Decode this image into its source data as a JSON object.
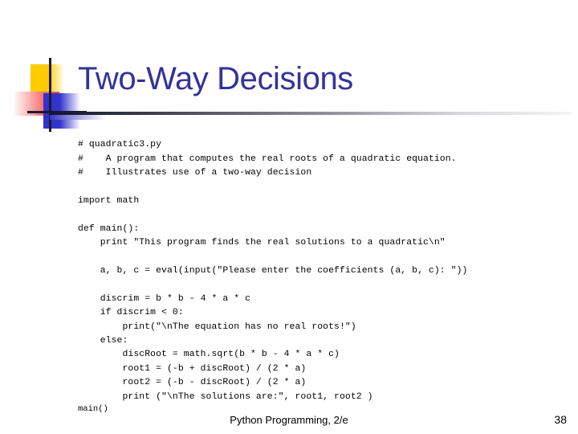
{
  "slide": {
    "title": "Two-Way Decisions",
    "title_color": "#333399"
  },
  "logo": {
    "yellow": "#FFCC00",
    "red": "#F24545",
    "blue": "#3333CC",
    "line": "#1a1a2e"
  },
  "code": {
    "lines": [
      "# quadratic3.py",
      "#    A program that computes the real roots of a quadratic equation.",
      "#    Illustrates use of a two-way decision",
      "",
      "import math",
      "",
      "def main():",
      "    print \"This program finds the real solutions to a quadratic\\n\"",
      "",
      "    a, b, c = eval(input(\"Please enter the coefficients (a, b, c): \"))",
      "",
      "    discrim = b * b - 4 * a * c",
      "    if discrim < 0:",
      "        print(\"\\nThe equation has no real roots!\")",
      "    else:",
      "        discRoot = math.sqrt(b * b - 4 * a * c)",
      "        root1 = (-b + discRoot) / (2 * a)",
      "        root2 = (-b - discRoot) / (2 * a)",
      "        print (\"\\nThe solutions are:\", root1, root2 )"
    ]
  },
  "footer": {
    "main_call": "main()",
    "center": "Python Programming, 2/e",
    "page_number": "38"
  }
}
